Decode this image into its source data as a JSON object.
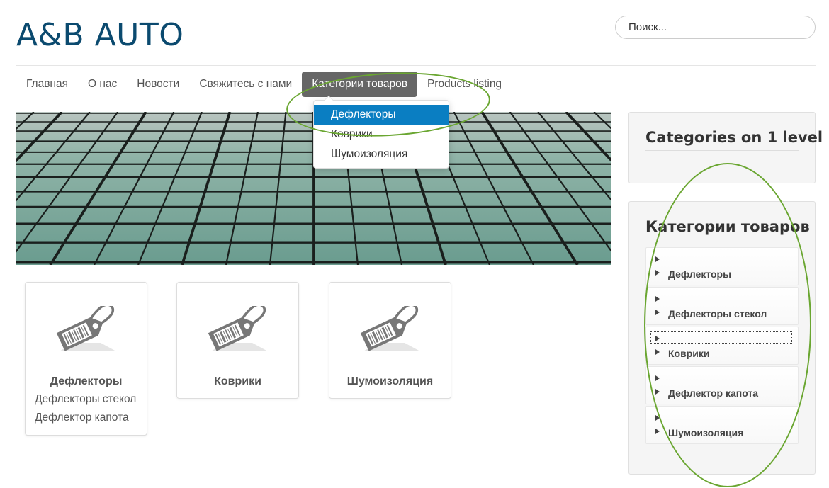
{
  "header": {
    "site_title": "A&B AUTO",
    "search_placeholder": "Поиск..."
  },
  "nav": {
    "items": [
      {
        "label": "Главная"
      },
      {
        "label": "О нас"
      },
      {
        "label": "Новости"
      },
      {
        "label": "Свяжитесь с нами"
      },
      {
        "label": "Категории товаров",
        "active": true
      },
      {
        "label": "Products listing"
      }
    ],
    "dropdown": [
      {
        "label": "Дефлекторы",
        "active": true
      },
      {
        "label": "Коврики"
      },
      {
        "label": "Шумоизоляция"
      }
    ]
  },
  "categories": [
    {
      "title": "Дефлекторы",
      "subcategories": [
        "Дефлекторы стекол",
        "Дефлектор капота"
      ]
    },
    {
      "title": "Коврики",
      "subcategories": []
    },
    {
      "title": "Шумоизоляция",
      "subcategories": []
    }
  ],
  "sidebar": {
    "module1_title": "Categories on 1 level",
    "module2_title": "Категории товаров",
    "tree": [
      {
        "label": "Дефлекторы"
      },
      {
        "label": "Дефлекторы стекол"
      },
      {
        "label": "Коврики"
      },
      {
        "label": "Дефлектор капота"
      },
      {
        "label": "Шумоизоляция"
      }
    ]
  },
  "colors": {
    "brand": "#0b4a6f",
    "nav_active": "#666666",
    "dropdown_active": "#0a7ec2",
    "annotation": "#6aa631"
  },
  "icons": {
    "category_image": "price-tag-barcode-icon",
    "tree_arrow": "triangle-right-icon"
  }
}
